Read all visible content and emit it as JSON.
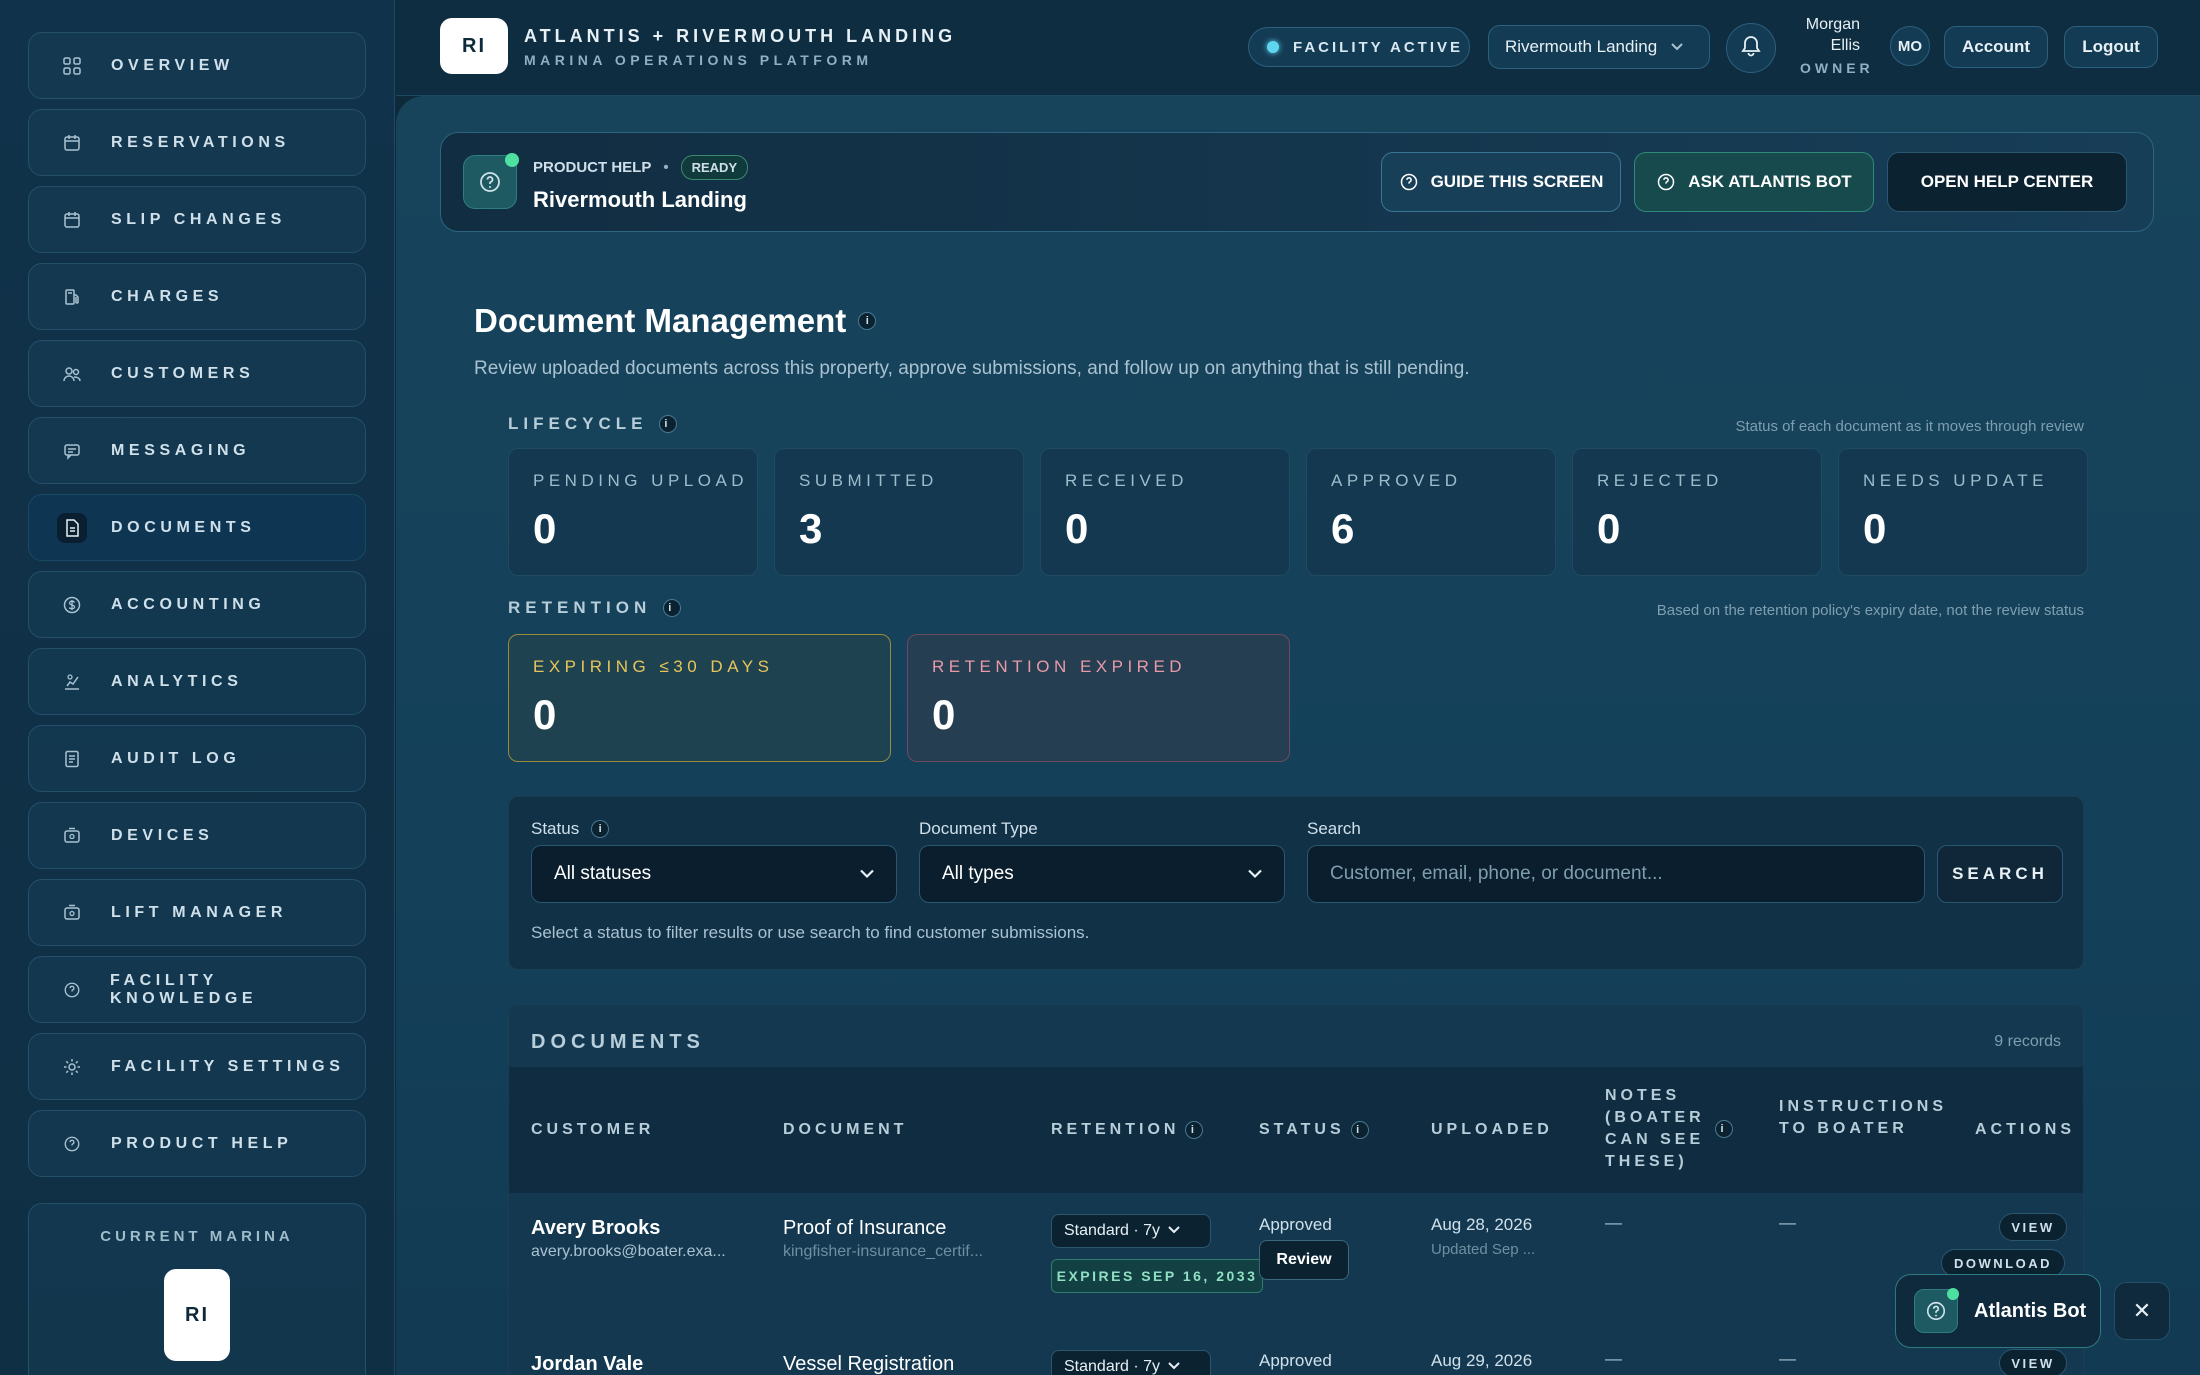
{
  "sidebar": {
    "items": [
      {
        "label": "OVERVIEW",
        "icon": "grid-icon"
      },
      {
        "label": "RESERVATIONS",
        "icon": "calendar-icon"
      },
      {
        "label": "SLIP CHANGES",
        "icon": "calendar-icon"
      },
      {
        "label": "CHARGES",
        "icon": "fuel-icon"
      },
      {
        "label": "CUSTOMERS",
        "icon": "users-icon"
      },
      {
        "label": "MESSAGING",
        "icon": "chat-icon"
      },
      {
        "label": "DOCUMENTS",
        "icon": "document-icon",
        "active": true
      },
      {
        "label": "ACCOUNTING",
        "icon": "dollar-icon"
      },
      {
        "label": "ANALYTICS",
        "icon": "chart-icon"
      },
      {
        "label": "AUDIT LOG",
        "icon": "log-icon"
      },
      {
        "label": "DEVICES",
        "icon": "device-icon"
      },
      {
        "label": "LIFT MANAGER",
        "icon": "lift-icon"
      },
      {
        "label": "FACILITY KNOWLEDGE",
        "icon": "help-circle-icon"
      },
      {
        "label": "FACILITY SETTINGS",
        "icon": "gear-icon"
      },
      {
        "label": "PRODUCT HELP",
        "icon": "help-circle-icon"
      }
    ],
    "current_marina_caption": "CURRENT MARINA",
    "current_marina_logo": "RI"
  },
  "header": {
    "logo": "RI",
    "title": "ATLANTIS + RIVERMOUTH LANDING",
    "subtitle": "MARINA OPERATIONS PLATFORM",
    "status": "FACILITY ACTIVE",
    "facility": "Rivermouth Landing",
    "user_name": "Morgan Ellis",
    "user_role": "OWNER",
    "user_initials": "MO",
    "account_label": "Account",
    "logout_label": "Logout"
  },
  "help_bar": {
    "caption": "PRODUCT HELP",
    "badge": "READY",
    "title": "Rivermouth Landing",
    "guide_label": "GUIDE THIS SCREEN",
    "ask_label": "ASK ATLANTIS BOT",
    "open_label": "OPEN HELP CENTER"
  },
  "page": {
    "title": "Document Management",
    "description": "Review uploaded documents across this property, approve submissions, and follow up on anything that is still pending."
  },
  "lifecycle": {
    "caption": "LIFECYCLE",
    "note": "Status of each document as it moves through review",
    "stats": [
      {
        "label": "PENDING UPLOAD",
        "value": "0"
      },
      {
        "label": "SUBMITTED",
        "value": "3"
      },
      {
        "label": "RECEIVED",
        "value": "0"
      },
      {
        "label": "APPROVED",
        "value": "6"
      },
      {
        "label": "REJECTED",
        "value": "0"
      },
      {
        "label": "NEEDS UPDATE",
        "value": "0"
      }
    ]
  },
  "retention": {
    "caption": "RETENTION",
    "note": "Based on the retention policy's expiry date, not the review status",
    "expiring_label": "EXPIRING ≤30 DAYS",
    "expiring_value": "0",
    "expired_label": "RETENTION EXPIRED",
    "expired_value": "0"
  },
  "filters": {
    "status_label": "Status",
    "status_value": "All statuses",
    "type_label": "Document Type",
    "type_value": "All types",
    "search_label": "Search",
    "search_placeholder": "Customer, email, phone, or document...",
    "search_button": "SEARCH",
    "hint": "Select a status to filter results or use search to find customer submissions."
  },
  "documents": {
    "caption": "DOCUMENTS",
    "count": "9 records",
    "columns": {
      "customer": "CUSTOMER",
      "document": "DOCUMENT",
      "retention": "RETENTION",
      "status": "STATUS",
      "uploaded": "UPLOADED",
      "notes": "NOTES (BOATER CAN SEE THESE)",
      "instructions": "INSTRUCTIONS TO BOATER",
      "actions": "ACTIONS"
    },
    "rows": [
      {
        "name": "Avery Brooks",
        "email": "avery.brooks@boater.exa...",
        "document": "Proof of Insurance",
        "file": "kingfisher-insurance_certif...",
        "retention": "Standard · 7y",
        "expires": "EXPIRES SEP 16, 2033",
        "status": "Approved",
        "review": "Review",
        "uploaded": "Aug 28, 2026",
        "updated": "Updated Sep ...",
        "notes": "—",
        "instructions": "—",
        "view": "VIEW",
        "download": "DOWNLOAD"
      },
      {
        "name": "Jordan Vale",
        "document": "Vessel Registration",
        "retention": "Standard · 7y",
        "status": "Approved",
        "uploaded": "Aug 29, 2026",
        "notes": "—",
        "instructions": "—",
        "view": "VIEW"
      }
    ]
  },
  "bot": {
    "label": "Atlantis Bot",
    "close": "✕"
  },
  "colors": {
    "expiring_border": "#9a8a3c",
    "expiring_text": "#e8c55a",
    "expired_border": "#6e4a5e",
    "expired_text": "#e89aa8",
    "accent_green": "#4ee0a0"
  }
}
